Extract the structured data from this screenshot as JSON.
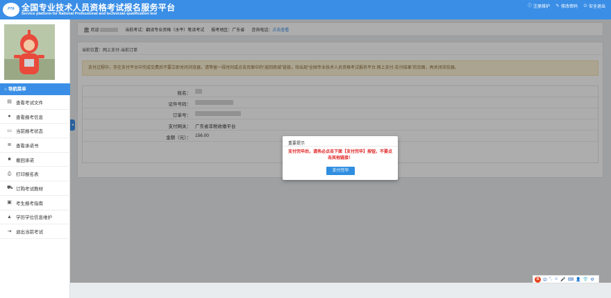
{
  "header": {
    "logo_text": "PTA",
    "title_cn": "全国专业技术人员资格考试报名服务平台",
    "title_en": "Service platform for National Professional and technician qualification test",
    "links": [
      {
        "icon": "info-icon",
        "glyph": "ⓘ",
        "label": "注册维护"
      },
      {
        "icon": "edit-icon",
        "glyph": "✎",
        "label": "修改密码"
      },
      {
        "icon": "power-icon",
        "glyph": "⏻",
        "label": "安全退出"
      }
    ]
  },
  "sidebar": {
    "nav_head": "导航菜单",
    "items": [
      {
        "icon": "file-icon",
        "glyph": "▤",
        "label": "查看考试文件"
      },
      {
        "icon": "info-circle-icon",
        "glyph": "●",
        "label": "查看报考信息"
      },
      {
        "icon": "monitor-icon",
        "glyph": "▭",
        "label": "当前报考状态"
      },
      {
        "icon": "list-icon",
        "glyph": "≣",
        "label": "查看承诺书"
      },
      {
        "icon": "check-icon",
        "glyph": "■",
        "label": "撤回承诺"
      },
      {
        "icon": "print-icon",
        "glyph": "⎙",
        "label": "打印报名表"
      },
      {
        "icon": "cart-icon",
        "glyph": "⛟",
        "label": "订购考试教材"
      },
      {
        "icon": "book-icon",
        "glyph": "▣",
        "label": "考生报考指南"
      },
      {
        "icon": "graduation-icon",
        "glyph": "▲",
        "label": "学历学位信息维护"
      },
      {
        "icon": "exit-icon",
        "glyph": "⇥",
        "label": "退出当前考试"
      }
    ]
  },
  "infobar": {
    "welcome": "欢迎",
    "exam_label": "当前考试：翻译专业资格（水平）笔译考试",
    "region_label": "报考地区：广东省",
    "phone_label": "咨询电话：",
    "phone_link": "点击查看"
  },
  "main": {
    "breadcrumb": "当前位置：网上支付-当前订单",
    "warning": "支付过程中，存在支付平台中完成交费后不要立即关闭浏览器，请等留一段时间或点击页面中的“返回商城”链接，待出现“全国专业技术人员资格考试报名平台 网上支付-支付结果”的页面，再关闭浏览器。",
    "rows": [
      {
        "label": "姓名：",
        "value": ""
      },
      {
        "label": "证件号码：",
        "value": ""
      },
      {
        "label": "订单号：",
        "value": ""
      },
      {
        "label": "支付网关：",
        "value": "广东省非税收缴平台"
      },
      {
        "label": "金额（元）：",
        "value": "156.00"
      }
    ]
  },
  "modal": {
    "title": "重要提示",
    "message": "支付完毕后，请务必点击下面【支付完毕】按钮，不要点击其他链接！",
    "button": "支付完毕"
  },
  "tray": {
    "logo": "S",
    "items": [
      "中",
      "°,",
      "☺",
      "🎤",
      "⌨",
      "👤",
      "👕",
      "⚙"
    ]
  },
  "colors": {
    "primary": "#3a8ee6",
    "warning_bg": "#fcf2d4",
    "modal_message": "#e02020"
  }
}
